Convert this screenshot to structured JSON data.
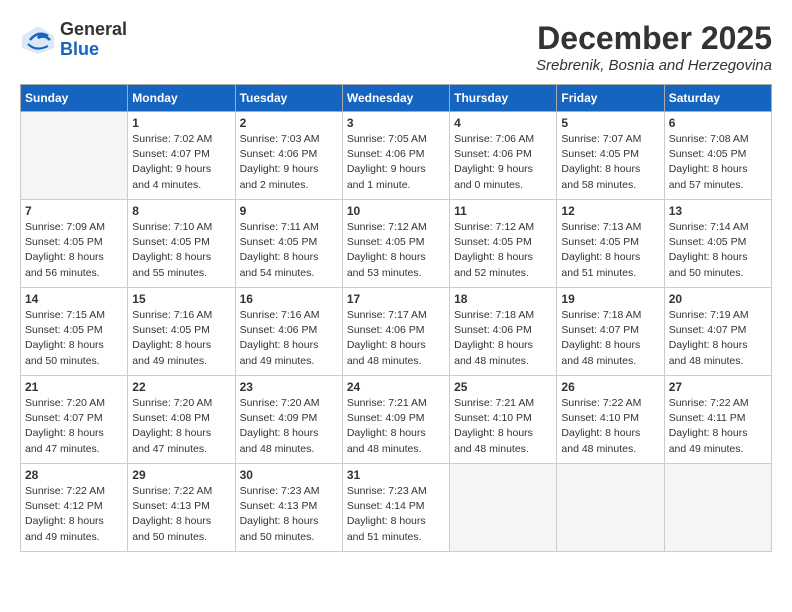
{
  "logo": {
    "general": "General",
    "blue": "Blue"
  },
  "header": {
    "month": "December 2025",
    "location": "Srebrenik, Bosnia and Herzegovina"
  },
  "days_of_week": [
    "Sunday",
    "Monday",
    "Tuesday",
    "Wednesday",
    "Thursday",
    "Friday",
    "Saturday"
  ],
  "weeks": [
    [
      {
        "day": "",
        "info": ""
      },
      {
        "day": "1",
        "info": "Sunrise: 7:02 AM\nSunset: 4:07 PM\nDaylight: 9 hours\nand 4 minutes."
      },
      {
        "day": "2",
        "info": "Sunrise: 7:03 AM\nSunset: 4:06 PM\nDaylight: 9 hours\nand 2 minutes."
      },
      {
        "day": "3",
        "info": "Sunrise: 7:05 AM\nSunset: 4:06 PM\nDaylight: 9 hours\nand 1 minute."
      },
      {
        "day": "4",
        "info": "Sunrise: 7:06 AM\nSunset: 4:06 PM\nDaylight: 9 hours\nand 0 minutes."
      },
      {
        "day": "5",
        "info": "Sunrise: 7:07 AM\nSunset: 4:05 PM\nDaylight: 8 hours\nand 58 minutes."
      },
      {
        "day": "6",
        "info": "Sunrise: 7:08 AM\nSunset: 4:05 PM\nDaylight: 8 hours\nand 57 minutes."
      }
    ],
    [
      {
        "day": "7",
        "info": "Sunrise: 7:09 AM\nSunset: 4:05 PM\nDaylight: 8 hours\nand 56 minutes."
      },
      {
        "day": "8",
        "info": "Sunrise: 7:10 AM\nSunset: 4:05 PM\nDaylight: 8 hours\nand 55 minutes."
      },
      {
        "day": "9",
        "info": "Sunrise: 7:11 AM\nSunset: 4:05 PM\nDaylight: 8 hours\nand 54 minutes."
      },
      {
        "day": "10",
        "info": "Sunrise: 7:12 AM\nSunset: 4:05 PM\nDaylight: 8 hours\nand 53 minutes."
      },
      {
        "day": "11",
        "info": "Sunrise: 7:12 AM\nSunset: 4:05 PM\nDaylight: 8 hours\nand 52 minutes."
      },
      {
        "day": "12",
        "info": "Sunrise: 7:13 AM\nSunset: 4:05 PM\nDaylight: 8 hours\nand 51 minutes."
      },
      {
        "day": "13",
        "info": "Sunrise: 7:14 AM\nSunset: 4:05 PM\nDaylight: 8 hours\nand 50 minutes."
      }
    ],
    [
      {
        "day": "14",
        "info": "Sunrise: 7:15 AM\nSunset: 4:05 PM\nDaylight: 8 hours\nand 50 minutes."
      },
      {
        "day": "15",
        "info": "Sunrise: 7:16 AM\nSunset: 4:05 PM\nDaylight: 8 hours\nand 49 minutes."
      },
      {
        "day": "16",
        "info": "Sunrise: 7:16 AM\nSunset: 4:06 PM\nDaylight: 8 hours\nand 49 minutes."
      },
      {
        "day": "17",
        "info": "Sunrise: 7:17 AM\nSunset: 4:06 PM\nDaylight: 8 hours\nand 48 minutes."
      },
      {
        "day": "18",
        "info": "Sunrise: 7:18 AM\nSunset: 4:06 PM\nDaylight: 8 hours\nand 48 minutes."
      },
      {
        "day": "19",
        "info": "Sunrise: 7:18 AM\nSunset: 4:07 PM\nDaylight: 8 hours\nand 48 minutes."
      },
      {
        "day": "20",
        "info": "Sunrise: 7:19 AM\nSunset: 4:07 PM\nDaylight: 8 hours\nand 48 minutes."
      }
    ],
    [
      {
        "day": "21",
        "info": "Sunrise: 7:20 AM\nSunset: 4:07 PM\nDaylight: 8 hours\nand 47 minutes."
      },
      {
        "day": "22",
        "info": "Sunrise: 7:20 AM\nSunset: 4:08 PM\nDaylight: 8 hours\nand 47 minutes."
      },
      {
        "day": "23",
        "info": "Sunrise: 7:20 AM\nSunset: 4:09 PM\nDaylight: 8 hours\nand 48 minutes."
      },
      {
        "day": "24",
        "info": "Sunrise: 7:21 AM\nSunset: 4:09 PM\nDaylight: 8 hours\nand 48 minutes."
      },
      {
        "day": "25",
        "info": "Sunrise: 7:21 AM\nSunset: 4:10 PM\nDaylight: 8 hours\nand 48 minutes."
      },
      {
        "day": "26",
        "info": "Sunrise: 7:22 AM\nSunset: 4:10 PM\nDaylight: 8 hours\nand 48 minutes."
      },
      {
        "day": "27",
        "info": "Sunrise: 7:22 AM\nSunset: 4:11 PM\nDaylight: 8 hours\nand 49 minutes."
      }
    ],
    [
      {
        "day": "28",
        "info": "Sunrise: 7:22 AM\nSunset: 4:12 PM\nDaylight: 8 hours\nand 49 minutes."
      },
      {
        "day": "29",
        "info": "Sunrise: 7:22 AM\nSunset: 4:13 PM\nDaylight: 8 hours\nand 50 minutes."
      },
      {
        "day": "30",
        "info": "Sunrise: 7:23 AM\nSunset: 4:13 PM\nDaylight: 8 hours\nand 50 minutes."
      },
      {
        "day": "31",
        "info": "Sunrise: 7:23 AM\nSunset: 4:14 PM\nDaylight: 8 hours\nand 51 minutes."
      },
      {
        "day": "",
        "info": ""
      },
      {
        "day": "",
        "info": ""
      },
      {
        "day": "",
        "info": ""
      }
    ]
  ]
}
